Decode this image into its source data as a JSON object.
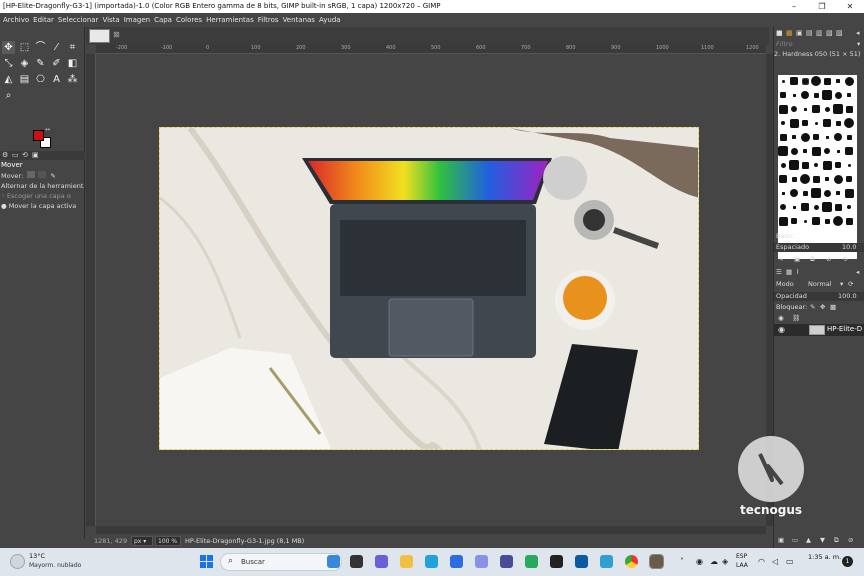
{
  "window": {
    "title": "[HP-Elite-Dragonfly-G3-1] (importada)-1.0 (Color RGB Entero gamma de 8 bits, GIMP built-in sRGB, 1 capa) 1200x720 – GIMP",
    "minimize": "–",
    "maximize": "❐",
    "close": "✕"
  },
  "menu": [
    "Archivo",
    "Editar",
    "Seleccionar",
    "Vista",
    "Imagen",
    "Capa",
    "Colores",
    "Herramientas",
    "Filtros",
    "Ventanas",
    "Ayuda"
  ],
  "tool_options": {
    "title": "Mover",
    "mode_label": "Mover:",
    "toggle_label": "Alternar de la herramienta",
    "option1": "Escoger una capa o",
    "option2": "Mover la capa activa"
  },
  "ruler": {
    "ticks": [
      "-200",
      "-100",
      "0",
      "100",
      "200",
      "300",
      "400",
      "500",
      "600",
      "700",
      "800",
      "900",
      "1000",
      "1100",
      "1200",
      "1300",
      "1400"
    ]
  },
  "status": {
    "coords": "1281, 429",
    "unit": "px",
    "zoom": "100 %",
    "file": "HP-Elite-Dragonfly-G3-1.jpg (8,1 MB)"
  },
  "brushes": {
    "filter_placeholder": "Filtro",
    "selected": "2. Hardness 050 (51 × 51)",
    "category": "Básic.",
    "spacing_label": "Espaciado",
    "spacing_value": "10.0"
  },
  "layers": {
    "mode_label": "Modo",
    "mode_value": "Normal",
    "opacity_label": "Opacidad",
    "opacity_value": "100.0",
    "lock_label": "Bloquear:",
    "layer_name": "HP-Elite-D"
  },
  "watermark": {
    "brand": "tecnogus"
  },
  "taskbar": {
    "temp": "13°C",
    "weather": "Mayorm. nublado",
    "search": "Buscar",
    "lang1": "ESP",
    "lang2": "LAA",
    "time": "1:35 a. m.",
    "notif_count": "1"
  }
}
